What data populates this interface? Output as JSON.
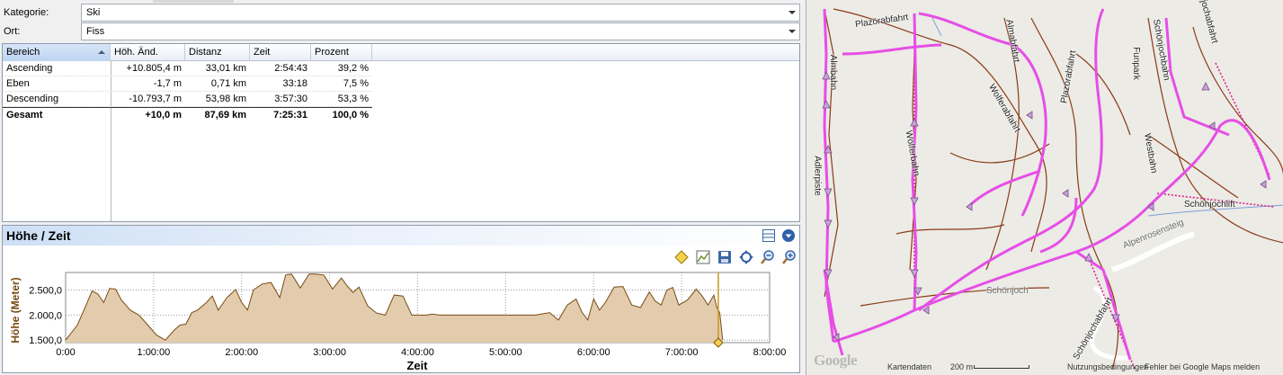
{
  "filters": {
    "category_label": "Kategorie:",
    "category_value": "Ski",
    "location_label": "Ort:",
    "location_value": "Fiss"
  },
  "table": {
    "columns": [
      "Bereich",
      "Höh. Änd.",
      "Distanz",
      "Zeit",
      "Prozent"
    ],
    "rows": [
      {
        "bereich": "Ascending",
        "hoehe": "+10.805,4 m",
        "distanz": "33,01 km",
        "zeit": "2:54:43",
        "prozent": "39,2 %"
      },
      {
        "bereich": "Eben",
        "hoehe": "-1,7 m",
        "distanz": "0,71 km",
        "zeit": "33:18",
        "prozent": "7,5 %"
      },
      {
        "bereich": "Descending",
        "hoehe": "-10.793,7 m",
        "distanz": "53,98 km",
        "zeit": "3:57:30",
        "prozent": "53,3 %"
      }
    ],
    "total": {
      "bereich": "Gesamt",
      "hoehe": "+10,0 m",
      "distanz": "87,69 km",
      "zeit": "7:25:31",
      "prozent": "100,0 %"
    }
  },
  "chart_panel": {
    "title": "Höhe / Zeit",
    "toolbar_icons": [
      "marker-icon",
      "chart-settings-icon",
      "save-icon",
      "zoom-fit-icon",
      "zoom-out-icon",
      "zoom-in-icon"
    ],
    "header_icons": [
      "layout-icon",
      "collapse-icon"
    ]
  },
  "chart_data": {
    "type": "area",
    "xlabel": "Zeit",
    "ylabel": "Höhe (Meter)",
    "x_tick_labels": [
      "0:00",
      "1:00:00",
      "2:00:00",
      "3:00:00",
      "4:00:00",
      "5:00:00",
      "6:00:00",
      "7:00:00",
      "8:00:00"
    ],
    "y_tick_labels": [
      "1.500,0",
      "2.000,0",
      "2.500,0"
    ],
    "xlim_minutes": [
      0,
      480
    ],
    "ylim": [
      1450,
      2850
    ],
    "grid": true,
    "fill_color": "#e2ccad",
    "line_color": "#7a4b12",
    "marker_color": "#c8961e",
    "cursor_minutes": 445,
    "series": [
      {
        "x_minutes": [
          0,
          8,
          14,
          18,
          22,
          26,
          30,
          34,
          38,
          44,
          50,
          56,
          62,
          68,
          74,
          78,
          82,
          86,
          90,
          96,
          100,
          104,
          110,
          116,
          120,
          124,
          128,
          134,
          140,
          146,
          150,
          154,
          160,
          166,
          170,
          176,
          182,
          188,
          192,
          196,
          200,
          206,
          212,
          218,
          224,
          230,
          236,
          240,
          246,
          250,
          255,
          260,
          270,
          280,
          300,
          320,
          330,
          336,
          342,
          348,
          352,
          356,
          360,
          364,
          368,
          374,
          380,
          386,
          392,
          398,
          402,
          406,
          410,
          414,
          418,
          424,
          430,
          434,
          438,
          442,
          444,
          446,
          448
        ],
        "y": [
          1500,
          1800,
          2200,
          2480,
          2420,
          2250,
          2530,
          2520,
          2300,
          2100,
          2000,
          1800,
          1600,
          1500,
          1700,
          1800,
          1820,
          2050,
          2100,
          2250,
          2380,
          2100,
          2350,
          2510,
          2250,
          2100,
          2500,
          2620,
          2650,
          2350,
          2800,
          2820,
          2540,
          2820,
          2820,
          2800,
          2520,
          2740,
          2580,
          2450,
          2560,
          2180,
          2040,
          2000,
          2400,
          2380,
          2000,
          2000,
          2000,
          2020,
          2000,
          2000,
          2000,
          2000,
          2000,
          2000,
          2050,
          1900,
          2200,
          2320,
          2060,
          1900,
          2320,
          2100,
          2250,
          2560,
          2570,
          2200,
          2150,
          2460,
          2280,
          2200,
          2500,
          2550,
          2200,
          2300,
          2520,
          2380,
          2200,
          2400,
          2150,
          2050,
          1500
        ]
      }
    ]
  },
  "map": {
    "labels": [
      "Plazörabfahrt",
      "Almabfahrt",
      "Almbahn",
      "Plazörabfahrt",
      "Funpark",
      "Schönjochbahn",
      "Wolferabfahrt",
      "Wölferbahn",
      "Adlerpiste",
      "Westbahn",
      "Schönjochlift",
      "Alpenrosensteig",
      "Schönjoch",
      "Schönjochabfahrt",
      "Schönjochabfahrt"
    ],
    "footer": {
      "data": "Kartendaten",
      "scale": "200 m",
      "terms": "Nutzungsbedingungen",
      "report": "Fehler bei Google Maps melden",
      "logo": "Google"
    },
    "track_color": "#e64ee6",
    "piste_color": "#8b3a14"
  }
}
